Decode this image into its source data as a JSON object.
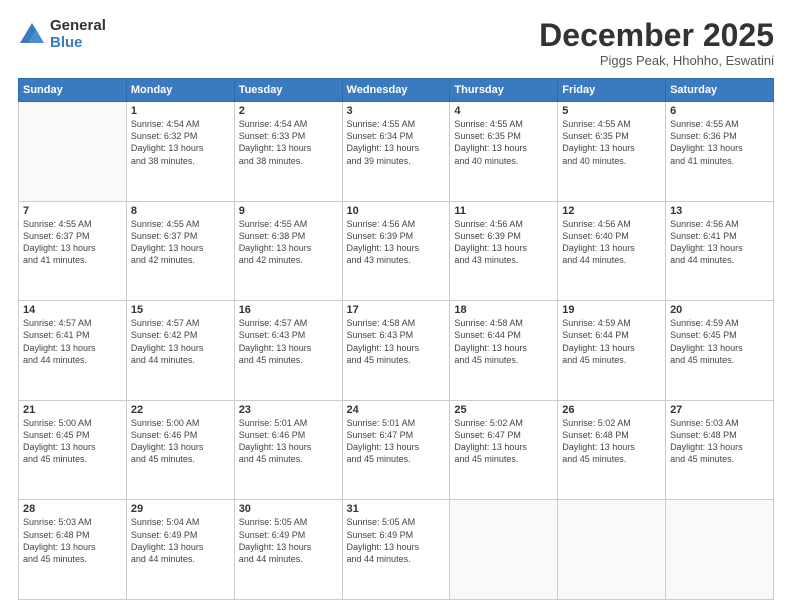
{
  "logo": {
    "general": "General",
    "blue": "Blue"
  },
  "header": {
    "month": "December 2025",
    "location": "Piggs Peak, Hhohho, Eswatini"
  },
  "days": [
    "Sunday",
    "Monday",
    "Tuesday",
    "Wednesday",
    "Thursday",
    "Friday",
    "Saturday"
  ],
  "weeks": [
    [
      {
        "day": "",
        "content": ""
      },
      {
        "day": "1",
        "content": "Sunrise: 4:54 AM\nSunset: 6:32 PM\nDaylight: 13 hours\nand 38 minutes."
      },
      {
        "day": "2",
        "content": "Sunrise: 4:54 AM\nSunset: 6:33 PM\nDaylight: 13 hours\nand 38 minutes."
      },
      {
        "day": "3",
        "content": "Sunrise: 4:55 AM\nSunset: 6:34 PM\nDaylight: 13 hours\nand 39 minutes."
      },
      {
        "day": "4",
        "content": "Sunrise: 4:55 AM\nSunset: 6:35 PM\nDaylight: 13 hours\nand 40 minutes."
      },
      {
        "day": "5",
        "content": "Sunrise: 4:55 AM\nSunset: 6:35 PM\nDaylight: 13 hours\nand 40 minutes."
      },
      {
        "day": "6",
        "content": "Sunrise: 4:55 AM\nSunset: 6:36 PM\nDaylight: 13 hours\nand 41 minutes."
      }
    ],
    [
      {
        "day": "7",
        "content": "Sunrise: 4:55 AM\nSunset: 6:37 PM\nDaylight: 13 hours\nand 41 minutes."
      },
      {
        "day": "8",
        "content": "Sunrise: 4:55 AM\nSunset: 6:37 PM\nDaylight: 13 hours\nand 42 minutes."
      },
      {
        "day": "9",
        "content": "Sunrise: 4:55 AM\nSunset: 6:38 PM\nDaylight: 13 hours\nand 42 minutes."
      },
      {
        "day": "10",
        "content": "Sunrise: 4:56 AM\nSunset: 6:39 PM\nDaylight: 13 hours\nand 43 minutes."
      },
      {
        "day": "11",
        "content": "Sunrise: 4:56 AM\nSunset: 6:39 PM\nDaylight: 13 hours\nand 43 minutes."
      },
      {
        "day": "12",
        "content": "Sunrise: 4:56 AM\nSunset: 6:40 PM\nDaylight: 13 hours\nand 44 minutes."
      },
      {
        "day": "13",
        "content": "Sunrise: 4:56 AM\nSunset: 6:41 PM\nDaylight: 13 hours\nand 44 minutes."
      }
    ],
    [
      {
        "day": "14",
        "content": "Sunrise: 4:57 AM\nSunset: 6:41 PM\nDaylight: 13 hours\nand 44 minutes."
      },
      {
        "day": "15",
        "content": "Sunrise: 4:57 AM\nSunset: 6:42 PM\nDaylight: 13 hours\nand 44 minutes."
      },
      {
        "day": "16",
        "content": "Sunrise: 4:57 AM\nSunset: 6:43 PM\nDaylight: 13 hours\nand 45 minutes."
      },
      {
        "day": "17",
        "content": "Sunrise: 4:58 AM\nSunset: 6:43 PM\nDaylight: 13 hours\nand 45 minutes."
      },
      {
        "day": "18",
        "content": "Sunrise: 4:58 AM\nSunset: 6:44 PM\nDaylight: 13 hours\nand 45 minutes."
      },
      {
        "day": "19",
        "content": "Sunrise: 4:59 AM\nSunset: 6:44 PM\nDaylight: 13 hours\nand 45 minutes."
      },
      {
        "day": "20",
        "content": "Sunrise: 4:59 AM\nSunset: 6:45 PM\nDaylight: 13 hours\nand 45 minutes."
      }
    ],
    [
      {
        "day": "21",
        "content": "Sunrise: 5:00 AM\nSunset: 6:45 PM\nDaylight: 13 hours\nand 45 minutes."
      },
      {
        "day": "22",
        "content": "Sunrise: 5:00 AM\nSunset: 6:46 PM\nDaylight: 13 hours\nand 45 minutes."
      },
      {
        "day": "23",
        "content": "Sunrise: 5:01 AM\nSunset: 6:46 PM\nDaylight: 13 hours\nand 45 minutes."
      },
      {
        "day": "24",
        "content": "Sunrise: 5:01 AM\nSunset: 6:47 PM\nDaylight: 13 hours\nand 45 minutes."
      },
      {
        "day": "25",
        "content": "Sunrise: 5:02 AM\nSunset: 6:47 PM\nDaylight: 13 hours\nand 45 minutes."
      },
      {
        "day": "26",
        "content": "Sunrise: 5:02 AM\nSunset: 6:48 PM\nDaylight: 13 hours\nand 45 minutes."
      },
      {
        "day": "27",
        "content": "Sunrise: 5:03 AM\nSunset: 6:48 PM\nDaylight: 13 hours\nand 45 minutes."
      }
    ],
    [
      {
        "day": "28",
        "content": "Sunrise: 5:03 AM\nSunset: 6:48 PM\nDaylight: 13 hours\nand 45 minutes."
      },
      {
        "day": "29",
        "content": "Sunrise: 5:04 AM\nSunset: 6:49 PM\nDaylight: 13 hours\nand 44 minutes."
      },
      {
        "day": "30",
        "content": "Sunrise: 5:05 AM\nSunset: 6:49 PM\nDaylight: 13 hours\nand 44 minutes."
      },
      {
        "day": "31",
        "content": "Sunrise: 5:05 AM\nSunset: 6:49 PM\nDaylight: 13 hours\nand 44 minutes."
      },
      {
        "day": "",
        "content": ""
      },
      {
        "day": "",
        "content": ""
      },
      {
        "day": "",
        "content": ""
      }
    ]
  ]
}
